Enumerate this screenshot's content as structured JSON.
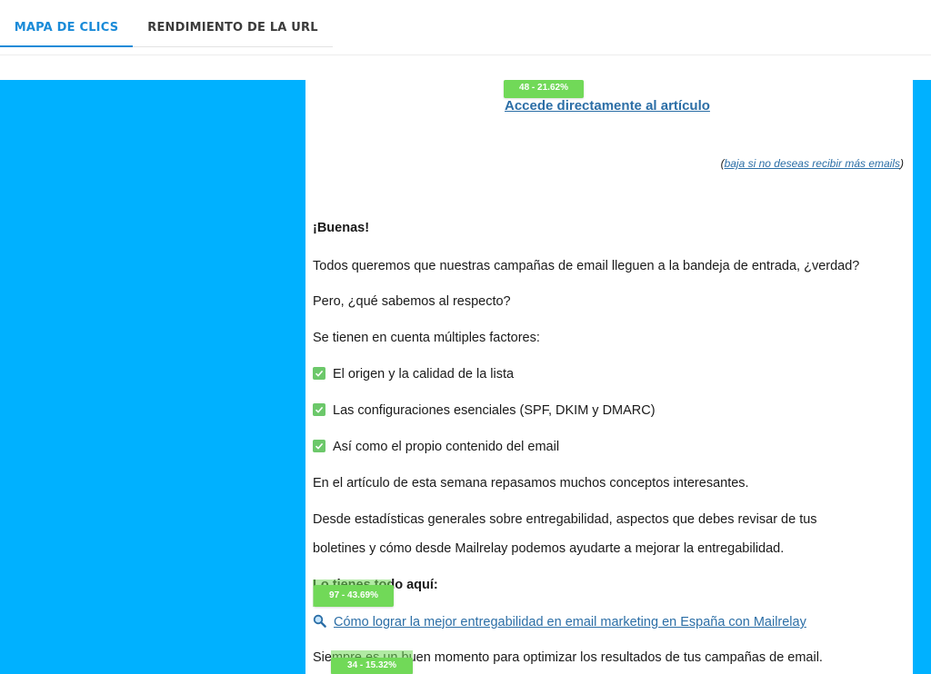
{
  "tabs": [
    {
      "label": "MAPA DE CLICS",
      "active": true
    },
    {
      "label": "RENDIMIENTO DE LA URL",
      "active": false
    }
  ],
  "colors": {
    "accent": "#1a8bd8",
    "heatmap_background": "#00b1ff",
    "badge": "#71d958",
    "link": "#2b6ea6"
  },
  "email": {
    "main_link": "Accede directamente al artículo",
    "unsubscribe": {
      "open": "(",
      "link": "baja si no deseas recibir más emails",
      "close": ")"
    },
    "greeting": "¡Buenas!",
    "paragraphs": [
      "Todos queremos que nuestras campañas de email lleguen a la bandeja de entrada, ¿verdad?",
      "Pero, ¿qué sabemos al respecto?",
      "Se tienen en cuenta múltiples factores:"
    ],
    "checklist": [
      "El origen y la calidad de la lista",
      "Las configuraciones esenciales (SPF, DKIM y DMARC)",
      "Así como el propio contenido del email"
    ],
    "paragraph_article": "En el artículo de esta semana repasamos muchos conceptos interesantes.",
    "paragraph_stats_1": "Desde estadísticas generales sobre entregabilidad, aspectos que debes revisar de tus",
    "paragraph_stats_2": "boletines y cómo desde Mailrelay podemos ayudarte a mejorar la entregabilidad.",
    "lo_tienes": "Lo tienes todo aquí:",
    "article_link": "Cómo lograr la mejor entregabilidad en email marketing en España con Mailrelay",
    "last_paragraph": "Siempre es un buen momento para optimizar los resultados de tus campañas de email."
  },
  "clicks": [
    {
      "label": "48 - 21.62%",
      "clicks": 48,
      "percent": 21.62
    },
    {
      "label": "97 - 43.69%",
      "clicks": 97,
      "percent": 43.69
    },
    {
      "label": "34 - 15.32%",
      "clicks": 34,
      "percent": 15.32
    }
  ]
}
